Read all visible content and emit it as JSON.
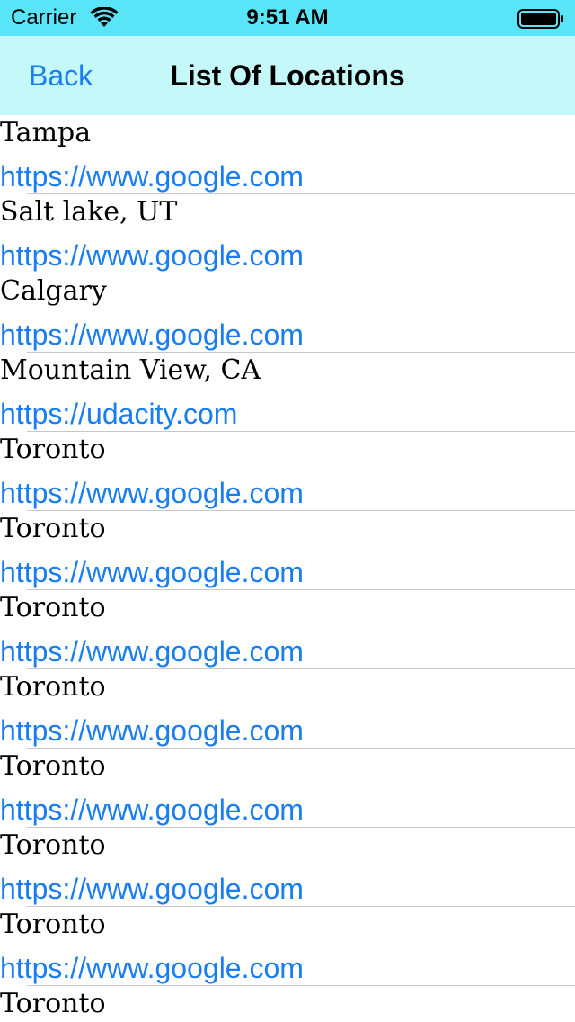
{
  "status_bar": {
    "carrier": "Carrier",
    "time": "9:51 AM",
    "icons": [
      "wifi-icon",
      "battery-icon"
    ]
  },
  "nav": {
    "back_label": "Back",
    "title": "List Of Locations"
  },
  "colors": {
    "status_bar_bg": "#5ae4f8",
    "nav_bar_bg": "#c4f8f9",
    "link": "#1a7ef0"
  },
  "locations": [
    {
      "name": "Tampa",
      "url": "https://www.google.com"
    },
    {
      "name": "Salt lake, UT",
      "url": "https://www.google.com"
    },
    {
      "name": "Calgary",
      "url": "https://www.google.com"
    },
    {
      "name": "Mountain View, CA",
      "url": "https://udacity.com"
    },
    {
      "name": "Toronto",
      "url": "https://www.google.com"
    },
    {
      "name": "Toronto",
      "url": "https://www.google.com"
    },
    {
      "name": "Toronto",
      "url": "https://www.google.com"
    },
    {
      "name": "Toronto",
      "url": "https://www.google.com"
    },
    {
      "name": "Toronto",
      "url": "https://www.google.com"
    },
    {
      "name": "Toronto",
      "url": "https://www.google.com"
    },
    {
      "name": "Toronto",
      "url": "https://www.google.com"
    },
    {
      "name": "Toronto",
      "url": ""
    }
  ]
}
